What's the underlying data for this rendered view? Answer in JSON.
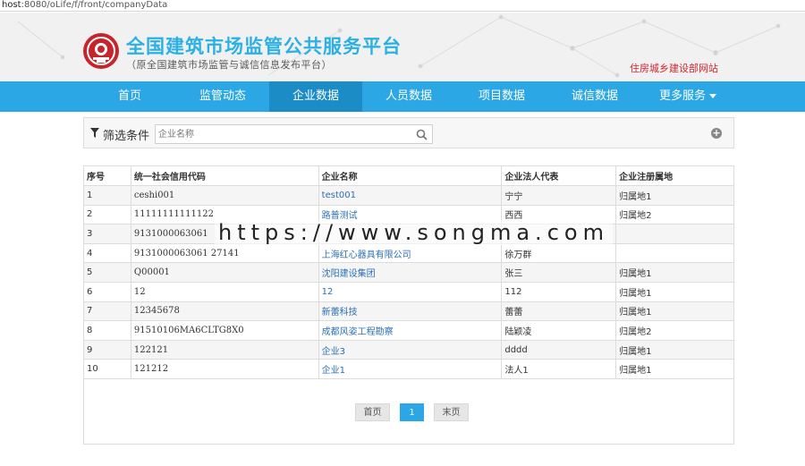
{
  "browser": {
    "url_prefix": "host",
    "url_rest": ":8080/oLife/f/front/companyData"
  },
  "header": {
    "title": "全国建筑市场监管公共服务平台",
    "subtitle": "（原全国建筑市场监管与诚信信息发布平台）",
    "ministry_link": "住房城乡建设部网站",
    "brand_color": "#2bb0e6",
    "logo_color": "#c8242b"
  },
  "nav": {
    "items": [
      {
        "label": "首页"
      },
      {
        "label": "监管动态"
      },
      {
        "label": "企业数据"
      },
      {
        "label": "人员数据"
      },
      {
        "label": "项目数据"
      },
      {
        "label": "诚信数据"
      },
      {
        "label": "更多服务"
      }
    ],
    "active": "企业数据",
    "bg_color": "#2aa7e4",
    "active_color": "#1b8cc6"
  },
  "filter": {
    "label": "筛选条件",
    "search_placeholder": "企业名称",
    "icons": [
      "filter-icon",
      "search-icon",
      "plus-circle-icon"
    ]
  },
  "table": {
    "headers": [
      "序号",
      "统一社会信用代码",
      "企业名称",
      "企业法人代表",
      "企业注册属地"
    ],
    "rows": [
      [
        "1",
        "ceshi001",
        "test001",
        "宁宁",
        "归属地1"
      ],
      [
        "2",
        "11111111111122",
        "路普测试",
        "西西",
        "归属地2"
      ],
      [
        "3",
        "9131000063061",
        "",
        "",
        ""
      ],
      [
        "4",
        "9131000063061 27141",
        "上海红心器具有限公司",
        "徐万群",
        ""
      ],
      [
        "5",
        "Q00001",
        "沈阳建设集团",
        "张三",
        "归属地1"
      ],
      [
        "6",
        "12",
        "12",
        "112",
        "归属地1"
      ],
      [
        "7",
        "12345678",
        "新蕾科技",
        "蕾蕾",
        "归属地1"
      ],
      [
        "8",
        "91510106MA6CLTG8X0",
        "成都风姿工程勘察",
        "陆颖凌",
        "归属地2"
      ],
      [
        "9",
        "122121",
        "企业3",
        "dddd",
        "归属地1"
      ],
      [
        "10",
        "121212",
        "企业1",
        "法人1",
        "归属地1"
      ]
    ]
  },
  "watermark": "https://www.songma.com",
  "pager": {
    "first": "首页",
    "current": "1",
    "last": "末页"
  }
}
